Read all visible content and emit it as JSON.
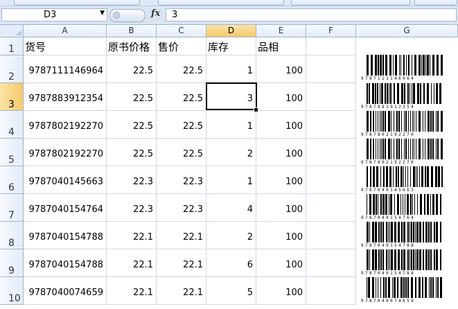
{
  "name_box": {
    "value": "D3"
  },
  "formula_bar": {
    "fx_label": "fx",
    "value": "3"
  },
  "columns": [
    "A",
    "B",
    "C",
    "D",
    "E",
    "F",
    "G"
  ],
  "selected_column": "D",
  "selected_row": "3",
  "header_row": {
    "row_label": "1",
    "cells": [
      "货号",
      "原书价格",
      "售价",
      "库存",
      "品相"
    ]
  },
  "rows": [
    {
      "row_label": "2",
      "isbn": "9787111146964",
      "orig_price": "22.5",
      "price": "22.5",
      "stock": "1",
      "condition": "100",
      "barcode": "barcode-image"
    },
    {
      "row_label": "3",
      "isbn": "9787883912354",
      "orig_price": "22.5",
      "price": "22.5",
      "stock": "3",
      "condition": "100",
      "barcode": "barcode-image"
    },
    {
      "row_label": "4",
      "isbn": "9787802192270",
      "orig_price": "22.5",
      "price": "22.5",
      "stock": "1",
      "condition": "100",
      "barcode": "barcode-image"
    },
    {
      "row_label": "5",
      "isbn": "9787802192270",
      "orig_price": "22.5",
      "price": "22.5",
      "stock": "2",
      "condition": "100",
      "barcode": "barcode-image"
    },
    {
      "row_label": "6",
      "isbn": "9787040145663",
      "orig_price": "22.3",
      "price": "22.3",
      "stock": "1",
      "condition": "100",
      "barcode": "barcode-image"
    },
    {
      "row_label": "7",
      "isbn": "9787040154764",
      "orig_price": "22.3",
      "price": "22.3",
      "stock": "4",
      "condition": "100",
      "barcode": "barcode-image"
    },
    {
      "row_label": "8",
      "isbn": "9787040154788",
      "orig_price": "22.1",
      "price": "22.1",
      "stock": "2",
      "condition": "100",
      "barcode": "barcode-image"
    },
    {
      "row_label": "9",
      "isbn": "9787040154788",
      "orig_price": "22.1",
      "price": "22.1",
      "stock": "6",
      "condition": "100",
      "barcode": "barcode-image"
    },
    {
      "row_label": "10",
      "isbn": "9787040074659",
      "orig_price": "22.1",
      "price": "22.1",
      "stock": "5",
      "condition": "100",
      "barcode": "barcode-image"
    }
  ],
  "colors": {
    "selection_header": "#f7c96b",
    "header_bg": "#e4ecf7",
    "gridline": "#d0d7e5"
  }
}
